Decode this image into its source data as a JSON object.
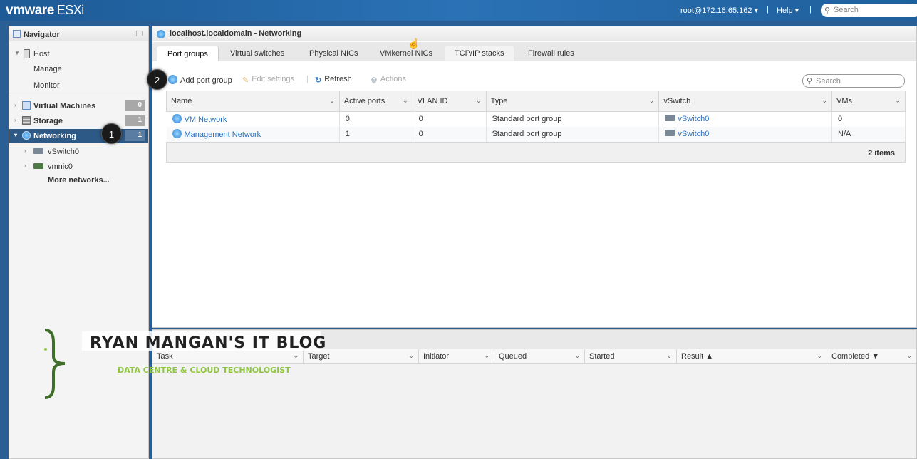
{
  "topbar": {
    "brand": "vmware",
    "product": "ESXi",
    "user": "root@172.16.65.162 ▾",
    "help": "Help ▾",
    "search_placeholder": "Search",
    "bg_color": "#2a72b5"
  },
  "navigator": {
    "title": "Navigator",
    "host": "Host",
    "manage": "Manage",
    "monitor": "Monitor",
    "items": [
      {
        "label": "Virtual Machines",
        "count": "0"
      },
      {
        "label": "Storage",
        "count": "1"
      },
      {
        "label": "Networking",
        "count": "1"
      }
    ],
    "children": [
      {
        "label": "vSwitch0"
      },
      {
        "label": "vmnic0"
      }
    ],
    "more": "More networks...",
    "selected_color": "#2d5986"
  },
  "callouts": {
    "one": "1",
    "two": "2"
  },
  "main": {
    "title": "localhost.localdomain - Networking",
    "tabs": [
      "Port groups",
      "Virtual switches",
      "Physical NICs",
      "VMkernel NICs",
      "TCP/IP stacks",
      "Firewall rules"
    ],
    "toolbar": {
      "add": "Add port group",
      "edit": "Edit settings",
      "refresh": "Refresh",
      "actions": "Actions"
    },
    "search_placeholder": "Search",
    "columns": [
      "Name",
      "Active ports",
      "VLAN ID",
      "Type",
      "vSwitch",
      "VMs"
    ],
    "rows": [
      {
        "name": "VM Network",
        "active_ports": "0",
        "vlan": "0",
        "type": "Standard port group",
        "vswitch": "vSwitch0",
        "vms": "0"
      },
      {
        "name": "Management Network",
        "active_ports": "1",
        "vlan": "0",
        "type": "Standard port group",
        "vswitch": "vSwitch0",
        "vms": "N/A"
      }
    ],
    "footer": "2 items",
    "link_color": "#2a6ebb"
  },
  "tasks": {
    "columns": [
      "Task",
      "Target",
      "Initiator",
      "Queued",
      "Started",
      "Result ▲",
      "Completed ▼"
    ]
  },
  "watermark": {
    "title": "RYAN MANGAN'S IT BLOG",
    "subtitle": "DATA CENTRE & CLOUD TECHNOLOGIST",
    "accent": "#8ec63f"
  }
}
